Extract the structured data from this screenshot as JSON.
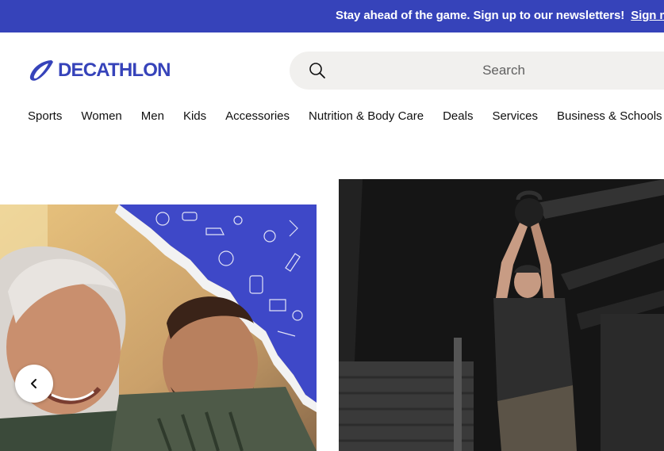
{
  "banner": {
    "message": "Stay ahead of the game. Sign up to our newsletters!",
    "link": "Sign me up"
  },
  "header": {
    "logo_text": "DECATHLON",
    "brand_color": "#3643ba",
    "search_placeholder": "Search"
  },
  "nav": {
    "items": [
      "Sports",
      "Women",
      "Men",
      "Kids",
      "Accessories",
      "Nutrition & Body Care",
      "Deals",
      "Services",
      "Business & Schools"
    ]
  },
  "carousel": {
    "prev_icon": "chevron-left-icon",
    "slides": [
      {
        "image": "grandmother-and-man-laughing-photo"
      },
      {
        "image": "man-lifting-kettlebell-photo"
      }
    ]
  }
}
